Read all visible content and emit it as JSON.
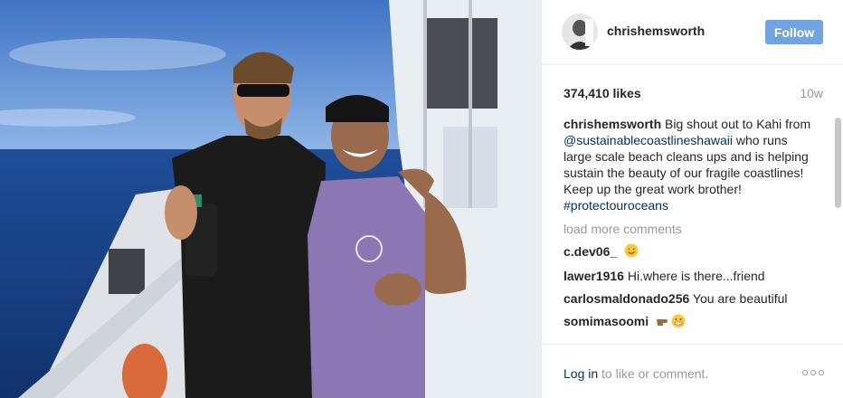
{
  "post": {
    "username": "chrishemsworth",
    "follow_label": "Follow",
    "likes": "374,410 likes",
    "age": "10w",
    "caption": {
      "username": "chrishemsworth",
      "text_1": "Big shout out to Kahi from",
      "mention": "@sustainablecoastlineshawaii",
      "text_2": "who runs large scale beach cleans ups and is helping sustain the beauty of our fragile coastlines! Keep up the great work brother!",
      "hashtag": "#protectouroceans"
    },
    "load_more": "load more comments",
    "comments": [
      {
        "username": "c.dev06_",
        "text": "",
        "emoji": "smiling-hearts-emoji"
      },
      {
        "username": "lawer1916",
        "text": "Hi.where is there...friend"
      },
      {
        "username": "carlosmaldonado256",
        "text": "You are beautiful"
      },
      {
        "username": "somimasoomi",
        "text": "",
        "emoji": "point-right-grin-emoji"
      }
    ],
    "login_link": "Log in",
    "login_rest": "to like or comment.",
    "colors": {
      "follow_bg": "#70a5e2",
      "link": "#003569",
      "muted": "#999999"
    }
  }
}
